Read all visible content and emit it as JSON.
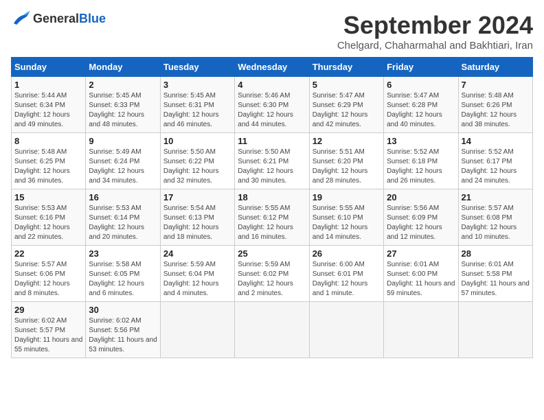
{
  "header": {
    "logo_general": "General",
    "logo_blue": "Blue",
    "month_title": "September 2024",
    "subtitle": "Chelgard, Chaharmahal and Bakhtiari, Iran"
  },
  "days_of_week": [
    "Sunday",
    "Monday",
    "Tuesday",
    "Wednesday",
    "Thursday",
    "Friday",
    "Saturday"
  ],
  "weeks": [
    [
      {
        "day": "1",
        "sunrise": "Sunrise: 5:44 AM",
        "sunset": "Sunset: 6:34 PM",
        "daylight": "Daylight: 12 hours and 49 minutes."
      },
      {
        "day": "2",
        "sunrise": "Sunrise: 5:45 AM",
        "sunset": "Sunset: 6:33 PM",
        "daylight": "Daylight: 12 hours and 48 minutes."
      },
      {
        "day": "3",
        "sunrise": "Sunrise: 5:45 AM",
        "sunset": "Sunset: 6:31 PM",
        "daylight": "Daylight: 12 hours and 46 minutes."
      },
      {
        "day": "4",
        "sunrise": "Sunrise: 5:46 AM",
        "sunset": "Sunset: 6:30 PM",
        "daylight": "Daylight: 12 hours and 44 minutes."
      },
      {
        "day": "5",
        "sunrise": "Sunrise: 5:47 AM",
        "sunset": "Sunset: 6:29 PM",
        "daylight": "Daylight: 12 hours and 42 minutes."
      },
      {
        "day": "6",
        "sunrise": "Sunrise: 5:47 AM",
        "sunset": "Sunset: 6:28 PM",
        "daylight": "Daylight: 12 hours and 40 minutes."
      },
      {
        "day": "7",
        "sunrise": "Sunrise: 5:48 AM",
        "sunset": "Sunset: 6:26 PM",
        "daylight": "Daylight: 12 hours and 38 minutes."
      }
    ],
    [
      {
        "day": "8",
        "sunrise": "Sunrise: 5:48 AM",
        "sunset": "Sunset: 6:25 PM",
        "daylight": "Daylight: 12 hours and 36 minutes."
      },
      {
        "day": "9",
        "sunrise": "Sunrise: 5:49 AM",
        "sunset": "Sunset: 6:24 PM",
        "daylight": "Daylight: 12 hours and 34 minutes."
      },
      {
        "day": "10",
        "sunrise": "Sunrise: 5:50 AM",
        "sunset": "Sunset: 6:22 PM",
        "daylight": "Daylight: 12 hours and 32 minutes."
      },
      {
        "day": "11",
        "sunrise": "Sunrise: 5:50 AM",
        "sunset": "Sunset: 6:21 PM",
        "daylight": "Daylight: 12 hours and 30 minutes."
      },
      {
        "day": "12",
        "sunrise": "Sunrise: 5:51 AM",
        "sunset": "Sunset: 6:20 PM",
        "daylight": "Daylight: 12 hours and 28 minutes."
      },
      {
        "day": "13",
        "sunrise": "Sunrise: 5:52 AM",
        "sunset": "Sunset: 6:18 PM",
        "daylight": "Daylight: 12 hours and 26 minutes."
      },
      {
        "day": "14",
        "sunrise": "Sunrise: 5:52 AM",
        "sunset": "Sunset: 6:17 PM",
        "daylight": "Daylight: 12 hours and 24 minutes."
      }
    ],
    [
      {
        "day": "15",
        "sunrise": "Sunrise: 5:53 AM",
        "sunset": "Sunset: 6:16 PM",
        "daylight": "Daylight: 12 hours and 22 minutes."
      },
      {
        "day": "16",
        "sunrise": "Sunrise: 5:53 AM",
        "sunset": "Sunset: 6:14 PM",
        "daylight": "Daylight: 12 hours and 20 minutes."
      },
      {
        "day": "17",
        "sunrise": "Sunrise: 5:54 AM",
        "sunset": "Sunset: 6:13 PM",
        "daylight": "Daylight: 12 hours and 18 minutes."
      },
      {
        "day": "18",
        "sunrise": "Sunrise: 5:55 AM",
        "sunset": "Sunset: 6:12 PM",
        "daylight": "Daylight: 12 hours and 16 minutes."
      },
      {
        "day": "19",
        "sunrise": "Sunrise: 5:55 AM",
        "sunset": "Sunset: 6:10 PM",
        "daylight": "Daylight: 12 hours and 14 minutes."
      },
      {
        "day": "20",
        "sunrise": "Sunrise: 5:56 AM",
        "sunset": "Sunset: 6:09 PM",
        "daylight": "Daylight: 12 hours and 12 minutes."
      },
      {
        "day": "21",
        "sunrise": "Sunrise: 5:57 AM",
        "sunset": "Sunset: 6:08 PM",
        "daylight": "Daylight: 12 hours and 10 minutes."
      }
    ],
    [
      {
        "day": "22",
        "sunrise": "Sunrise: 5:57 AM",
        "sunset": "Sunset: 6:06 PM",
        "daylight": "Daylight: 12 hours and 8 minutes."
      },
      {
        "day": "23",
        "sunrise": "Sunrise: 5:58 AM",
        "sunset": "Sunset: 6:05 PM",
        "daylight": "Daylight: 12 hours and 6 minutes."
      },
      {
        "day": "24",
        "sunrise": "Sunrise: 5:59 AM",
        "sunset": "Sunset: 6:04 PM",
        "daylight": "Daylight: 12 hours and 4 minutes."
      },
      {
        "day": "25",
        "sunrise": "Sunrise: 5:59 AM",
        "sunset": "Sunset: 6:02 PM",
        "daylight": "Daylight: 12 hours and 2 minutes."
      },
      {
        "day": "26",
        "sunrise": "Sunrise: 6:00 AM",
        "sunset": "Sunset: 6:01 PM",
        "daylight": "Daylight: 12 hours and 1 minute."
      },
      {
        "day": "27",
        "sunrise": "Sunrise: 6:01 AM",
        "sunset": "Sunset: 6:00 PM",
        "daylight": "Daylight: 11 hours and 59 minutes."
      },
      {
        "day": "28",
        "sunrise": "Sunrise: 6:01 AM",
        "sunset": "Sunset: 5:58 PM",
        "daylight": "Daylight: 11 hours and 57 minutes."
      }
    ],
    [
      {
        "day": "29",
        "sunrise": "Sunrise: 6:02 AM",
        "sunset": "Sunset: 5:57 PM",
        "daylight": "Daylight: 11 hours and 55 minutes."
      },
      {
        "day": "30",
        "sunrise": "Sunrise: 6:02 AM",
        "sunset": "Sunset: 5:56 PM",
        "daylight": "Daylight: 11 hours and 53 minutes."
      },
      {
        "day": "",
        "sunrise": "",
        "sunset": "",
        "daylight": ""
      },
      {
        "day": "",
        "sunrise": "",
        "sunset": "",
        "daylight": ""
      },
      {
        "day": "",
        "sunrise": "",
        "sunset": "",
        "daylight": ""
      },
      {
        "day": "",
        "sunrise": "",
        "sunset": "",
        "daylight": ""
      },
      {
        "day": "",
        "sunrise": "",
        "sunset": "",
        "daylight": ""
      }
    ]
  ]
}
